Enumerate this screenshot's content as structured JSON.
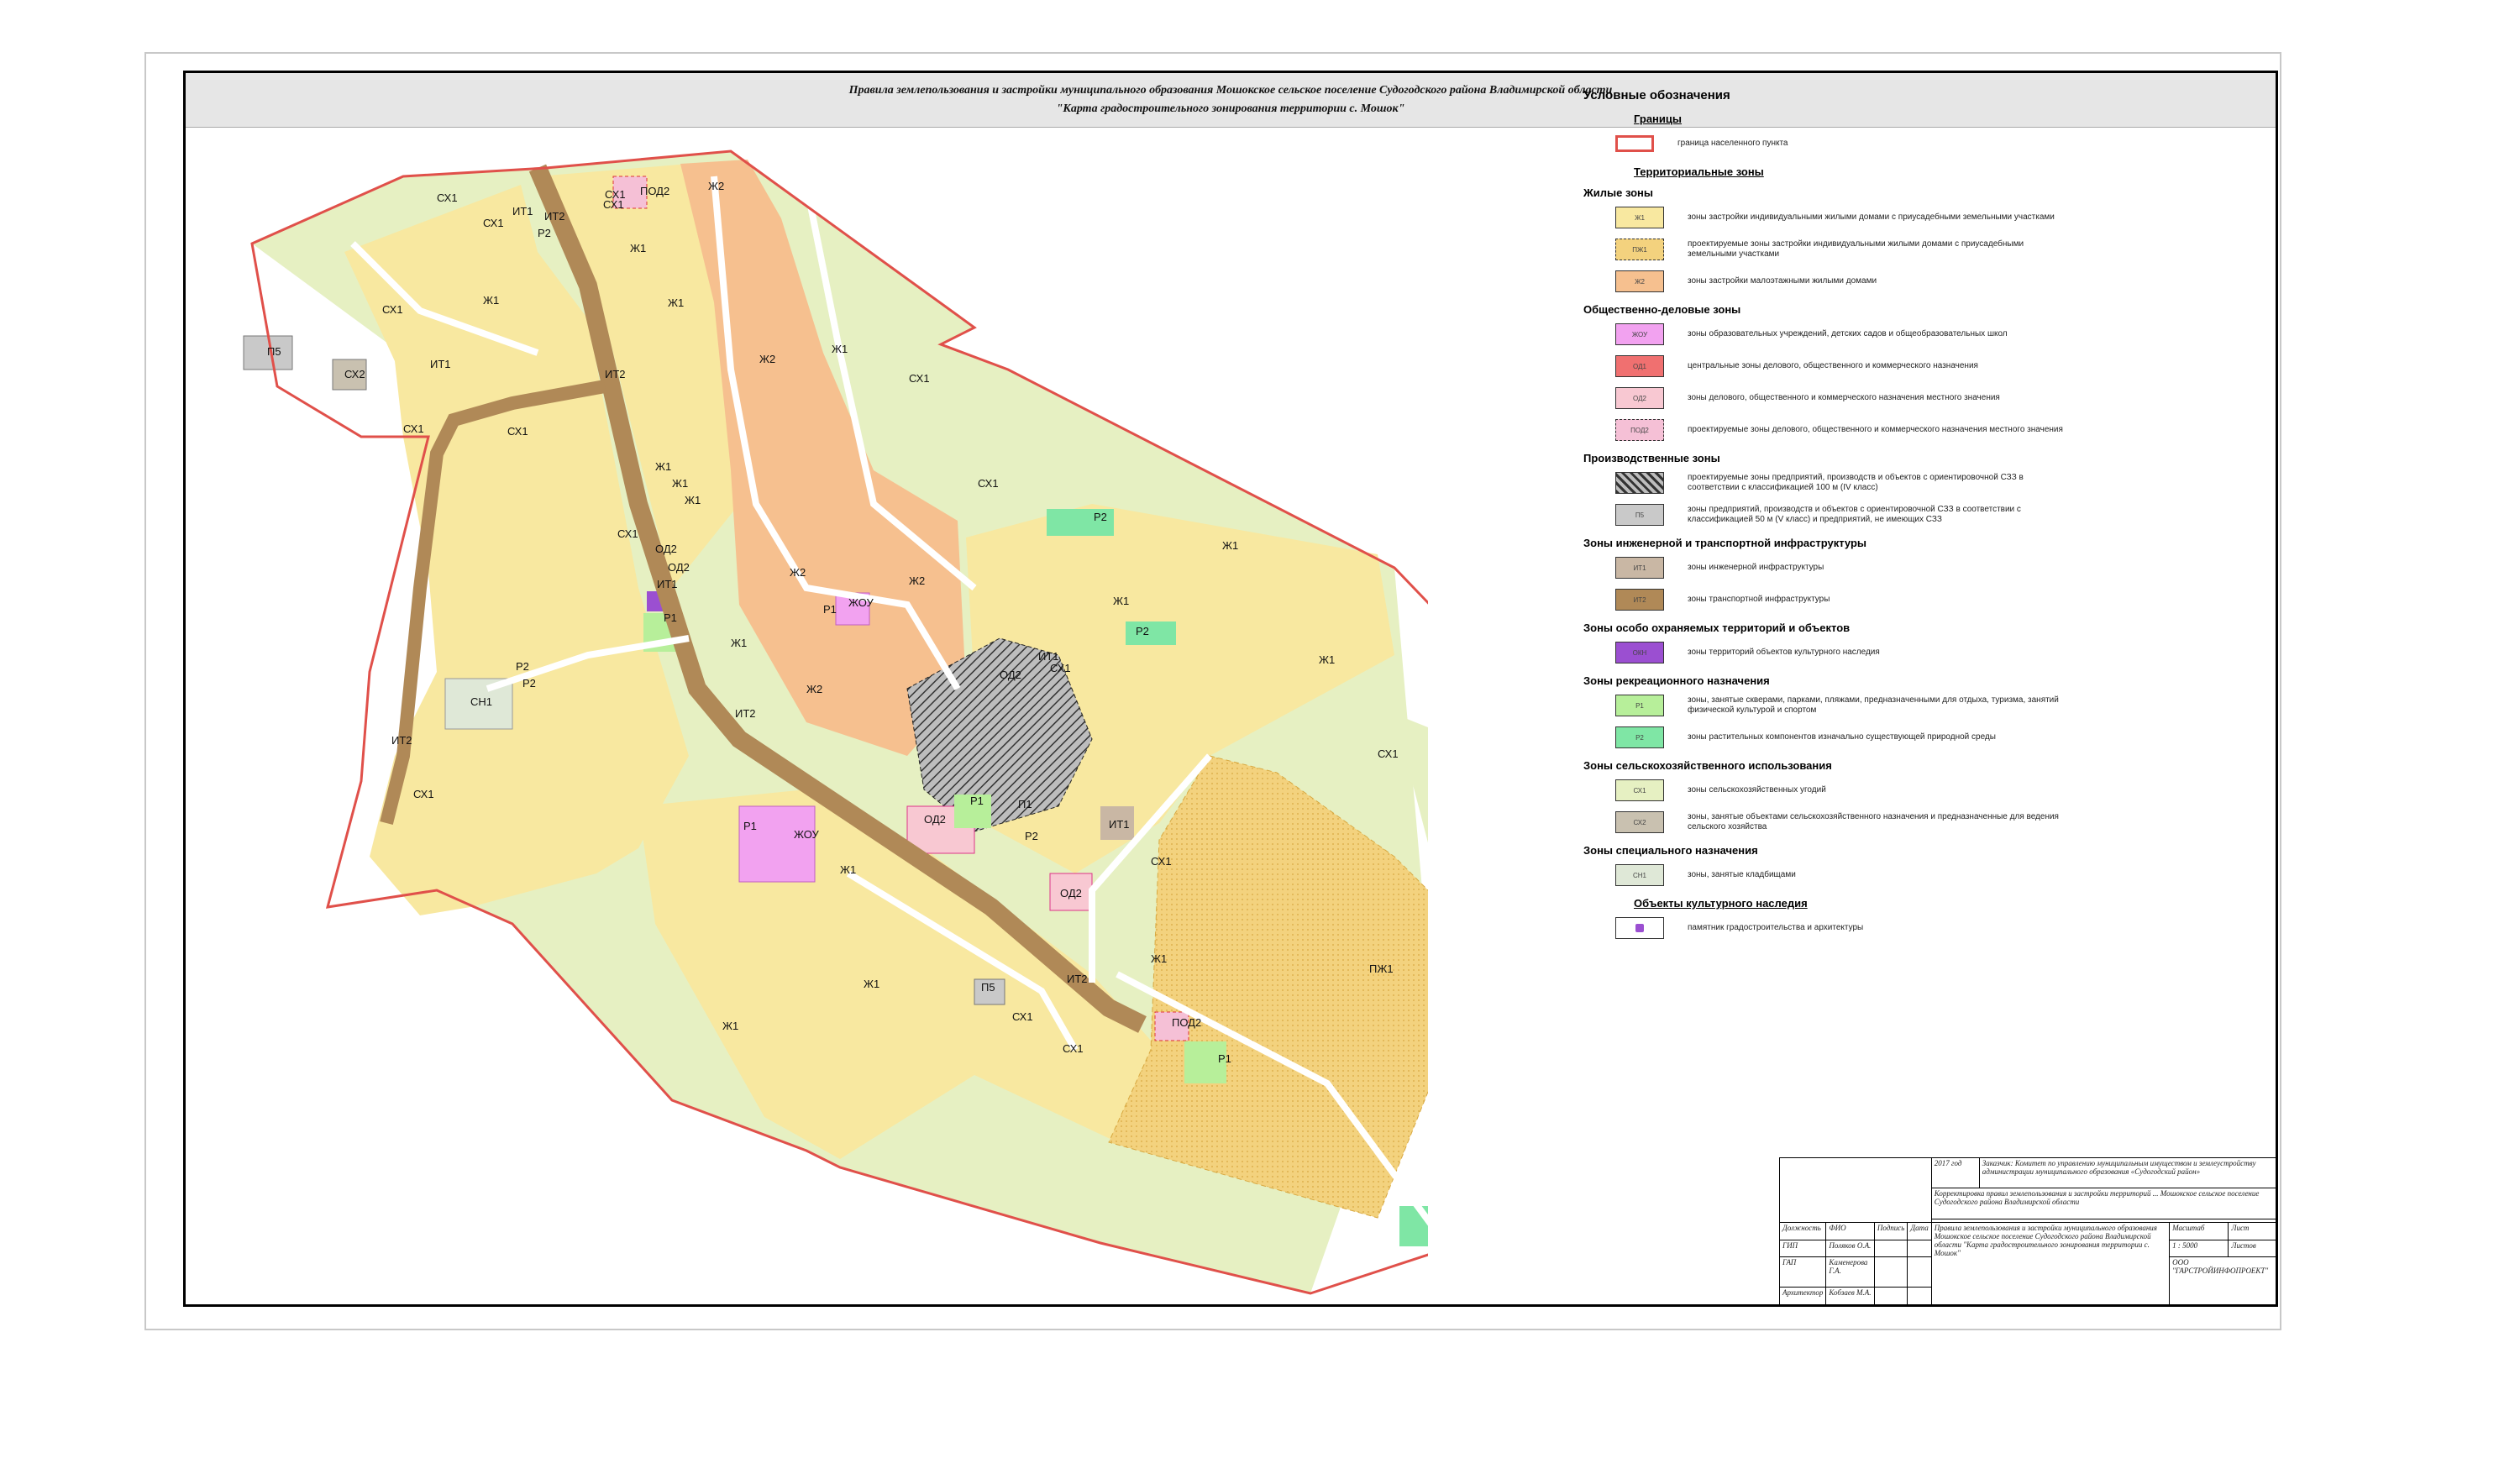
{
  "header": {
    "line1": "Правила землепользования и застройки муниципального образования Мошокское сельское поселение Судогодского района Владимирской области",
    "line2": "\"Карта градостроительного зонирования территории с. Мошок\""
  },
  "colors": {
    "boundary": "#e0504a",
    "zh1": "#f8e8a0",
    "zh2": "#f6c08f",
    "pzh1": "#f3d27e",
    "sx1": "#e6f0c2",
    "sx2": "#c9c1b0",
    "p1": "#b7ef9a",
    "p2": "#7fe6a5",
    "zhou": "#f2a2f0",
    "od2": "#f8c8d2",
    "pod2": "#f5c0d6",
    "it1": "#c9b7a4",
    "it2": "#b08957",
    "p5": "#c9c9c9",
    "sn1": "#dfe8d7",
    "okn": "#9b4fd1",
    "road": "#ffffff"
  },
  "map_labels": [
    {
      "t": "СХ1",
      "k": "sx1"
    },
    {
      "t": "СХ1",
      "k": "sx1"
    },
    {
      "t": "ИТ1",
      "k": "it1"
    },
    {
      "t": "ИТ2",
      "k": "it2"
    },
    {
      "t": "Ж2",
      "k": "zh2"
    },
    {
      "t": "СХ1",
      "k": "sx1"
    },
    {
      "t": "ПОД2",
      "k": "pod2"
    },
    {
      "t": "СХ1",
      "k": "sx1"
    },
    {
      "t": "Р2",
      "k": "p2"
    },
    {
      "t": "Ж1",
      "k": "zh1"
    },
    {
      "t": "Ж1",
      "k": "zh1"
    },
    {
      "t": "СХ1",
      "k": "sx1"
    },
    {
      "t": "П5",
      "k": "p5"
    },
    {
      "t": "СХ2",
      "k": "sx2"
    },
    {
      "t": "ИТ1",
      "k": "it1"
    },
    {
      "t": "Ж1",
      "k": "zh1"
    },
    {
      "t": "Ж2",
      "k": "zh2"
    },
    {
      "t": "Ж1",
      "k": "zh1"
    },
    {
      "t": "СХ1",
      "k": "sx1"
    },
    {
      "t": "СХ1",
      "k": "sx1"
    },
    {
      "t": "СХ1",
      "k": "sx1"
    },
    {
      "t": "ИТ2",
      "k": "it2"
    },
    {
      "t": "Ж1",
      "k": "zh1"
    },
    {
      "t": "Ж1",
      "k": "zh1"
    },
    {
      "t": "Ж1",
      "k": "zh1"
    },
    {
      "t": "ОД2",
      "k": "od2"
    },
    {
      "t": "ОД2",
      "k": "od2"
    },
    {
      "t": "ИТ1",
      "k": "it1"
    },
    {
      "t": "Р1",
      "k": "p1"
    },
    {
      "t": "СХ1",
      "k": "sx1"
    },
    {
      "t": "Ж2",
      "k": "zh2"
    },
    {
      "t": "ЖОУ",
      "k": "zhou"
    },
    {
      "t": "Ж2",
      "k": "zh2"
    },
    {
      "t": "Р1",
      "k": "p1"
    },
    {
      "t": "Р2",
      "k": "p2"
    },
    {
      "t": "СХ1",
      "k": "sx1"
    },
    {
      "t": "Ж1",
      "k": "zh1"
    },
    {
      "t": "Ж1",
      "k": "zh1"
    },
    {
      "t": "Р2",
      "k": "p2"
    },
    {
      "t": "ИТ1",
      "k": "it1"
    },
    {
      "t": "СХ1",
      "k": "sx1"
    },
    {
      "t": "ОД2",
      "k": "od2"
    },
    {
      "t": "Ж1",
      "k": "zh1"
    },
    {
      "t": "СН1",
      "k": "sn1"
    },
    {
      "t": "Р2",
      "k": "p2"
    },
    {
      "t": "Р2",
      "k": "p2"
    },
    {
      "t": "ИТ2",
      "k": "it2"
    },
    {
      "t": "Ж2",
      "k": "zh2"
    },
    {
      "t": "Ж1",
      "k": "zh1"
    },
    {
      "t": "ИТ2",
      "k": "it2"
    },
    {
      "t": "СХ1",
      "k": "sx1"
    },
    {
      "t": "ПЖ1",
      "k": "pzh1"
    },
    {
      "t": "ЖОУ",
      "k": "zhou"
    },
    {
      "t": "Р1",
      "k": "p1"
    },
    {
      "t": "ОД2",
      "k": "od2"
    },
    {
      "t": "Р1",
      "k": "p1"
    },
    {
      "t": "Р2",
      "k": "p2"
    },
    {
      "t": "ИТ1",
      "k": "it1"
    },
    {
      "t": "СХ1",
      "k": "sx1"
    },
    {
      "t": "П5",
      "k": "p5"
    },
    {
      "t": "ОД2",
      "k": "od2"
    },
    {
      "t": "ИТ2",
      "k": "it2"
    },
    {
      "t": "ПОД2",
      "k": "pod2"
    },
    {
      "t": "Р1",
      "k": "p1"
    },
    {
      "t": "СХ1",
      "k": "sx1"
    },
    {
      "t": "СХ1",
      "k": "sx1"
    },
    {
      "t": "Р2",
      "k": "p2"
    },
    {
      "t": "Ж1",
      "k": "zh1"
    },
    {
      "t": "Ж1",
      "k": "zh1"
    },
    {
      "t": "Ж1",
      "k": "zh1"
    },
    {
      "t": "СХ1",
      "k": "sx1"
    },
    {
      "t": "СХ1",
      "k": "sx1"
    },
    {
      "t": "СХ1",
      "k": "sx1"
    },
    {
      "t": "Ж1",
      "k": "zh1"
    },
    {
      "t": "П1",
      "k": "p5"
    }
  ],
  "legend": {
    "title": "Условные обозначения",
    "sections": [
      {
        "title": "Границы",
        "u": true,
        "items": [
          {
            "code": "",
            "key": "boundary",
            "text": "граница населенного пункта",
            "outline": true
          }
        ]
      },
      {
        "title": "Территориальные зоны",
        "u": true,
        "items": []
      },
      {
        "title": "Жилые зоны",
        "u": false,
        "items": [
          {
            "code": "Ж1",
            "key": "zh1",
            "text": "зоны застройки индивидуальными жилыми домами с приусадебными земельными участками"
          },
          {
            "code": "ПЖ1",
            "key": "pzh1",
            "text": "проектируемые зоны застройки индивидуальными жилыми домами с приусадебными земельными участками",
            "dashed": true
          },
          {
            "code": "Ж2",
            "key": "zh2",
            "text": "зоны застройки малоэтажными жилыми домами"
          }
        ]
      },
      {
        "title": "Общественно-деловые зоны",
        "u": false,
        "items": [
          {
            "code": "ЖОУ",
            "key": "zhou",
            "text": "зоны образовательных учреждений, детских садов и общеобразовательных школ"
          },
          {
            "code": "ОД1",
            "key": "od1",
            "text": "центральные зоны делового, общественного и коммерческого назначения"
          },
          {
            "code": "ОД2",
            "key": "od2",
            "text": "зоны делового, общественного и коммерческого назначения местного значения"
          },
          {
            "code": "ПОД2",
            "key": "pod2",
            "text": "проектируемые зоны делового, общественного и коммерческого назначения местного значения",
            "dashed": true
          }
        ]
      },
      {
        "title": "Производственные зоны",
        "u": false,
        "items": [
          {
            "code": "",
            "key": "prod",
            "text": "проектируемые зоны предприятий, производств и объектов с ориентировочной СЗЗ в соответствии с классификацией 100 м (IV класс)",
            "hatch": true
          },
          {
            "code": "П5",
            "key": "p5",
            "text": "зоны предприятий, производств и объектов с ориентировочной СЗЗ в соответствии с классификацией 50 м (V класс) и предприятий, не имеющих СЗЗ"
          }
        ]
      },
      {
        "title": "Зоны инженерной и транспортной инфраструктуры",
        "u": false,
        "items": [
          {
            "code": "ИТ1",
            "key": "it1",
            "text": "зоны инженерной инфраструктуры"
          },
          {
            "code": "ИТ2",
            "key": "it2",
            "text": "зоны транспортной инфраструктуры"
          }
        ]
      },
      {
        "title": "Зоны особо охраняемых территорий и объектов",
        "u": false,
        "items": [
          {
            "code": "ОКН",
            "key": "okn",
            "text": "зоны территорий объектов культурного наследия"
          }
        ]
      },
      {
        "title": "Зоны рекреационного назначения",
        "u": false,
        "items": [
          {
            "code": "Р1",
            "key": "p1",
            "text": "зоны, занятые скверами, парками, пляжами, предназначенными для отдыха, туризма, занятий физической культурой и спортом"
          },
          {
            "code": "Р2",
            "key": "p2",
            "text": "зоны растительных компонентов изначально существующей природной среды"
          }
        ]
      },
      {
        "title": "Зоны сельскохозяйственного использования",
        "u": false,
        "items": [
          {
            "code": "СХ1",
            "key": "sx1",
            "text": "зоны сельскохозяйственных угодий"
          },
          {
            "code": "СХ2",
            "key": "sx2",
            "text": "зоны, занятые объектами сельскохозяйственного назначения и предназначенные для ведения сельского хозяйства"
          }
        ]
      },
      {
        "title": "Зоны специального назначения",
        "u": false,
        "items": [
          {
            "code": "СН1",
            "key": "sn1",
            "text": "зоны, занятые кладбищами"
          }
        ]
      },
      {
        "title": "Объекты культурного наследия",
        "u": true,
        "items": [
          {
            "code": "",
            "key": "monument",
            "text": "памятник градостроительства и архитектуры",
            "icon": true
          }
        ]
      }
    ]
  },
  "stamp": {
    "year": "2017 год",
    "customer": "Заказчик: Комитет по управлению муниципальным имуществом и землеустройству администрации муниципального образования «Судогодский район»",
    "project": "Корректировка правил землепользования и застройки территорий ... Мошокское сельское поселение Судогодского района Владимирской области",
    "cols": [
      "Должность",
      "ФИО",
      "Подпись",
      "Дата"
    ],
    "rows": [
      [
        "ГИП",
        "Поляков О.А."
      ],
      [
        "ГАП",
        "Каменерова Г.А."
      ],
      [
        "Архитектор",
        "Кобзаев М.А."
      ]
    ],
    "title": "Правила землепользования и застройки муниципального образования Мошокское сельское поселение Судогодского района Владимирской области \"Карта градостроительного зонирования территории с. Мошок\"",
    "scale_label": "Масштаб",
    "sheet_label": "Лист",
    "sheets_label": "Листов",
    "scale": "1 : 5000",
    "org": "ООО \"ГАРСТРОЙИНФОПРОЕКТ\""
  }
}
